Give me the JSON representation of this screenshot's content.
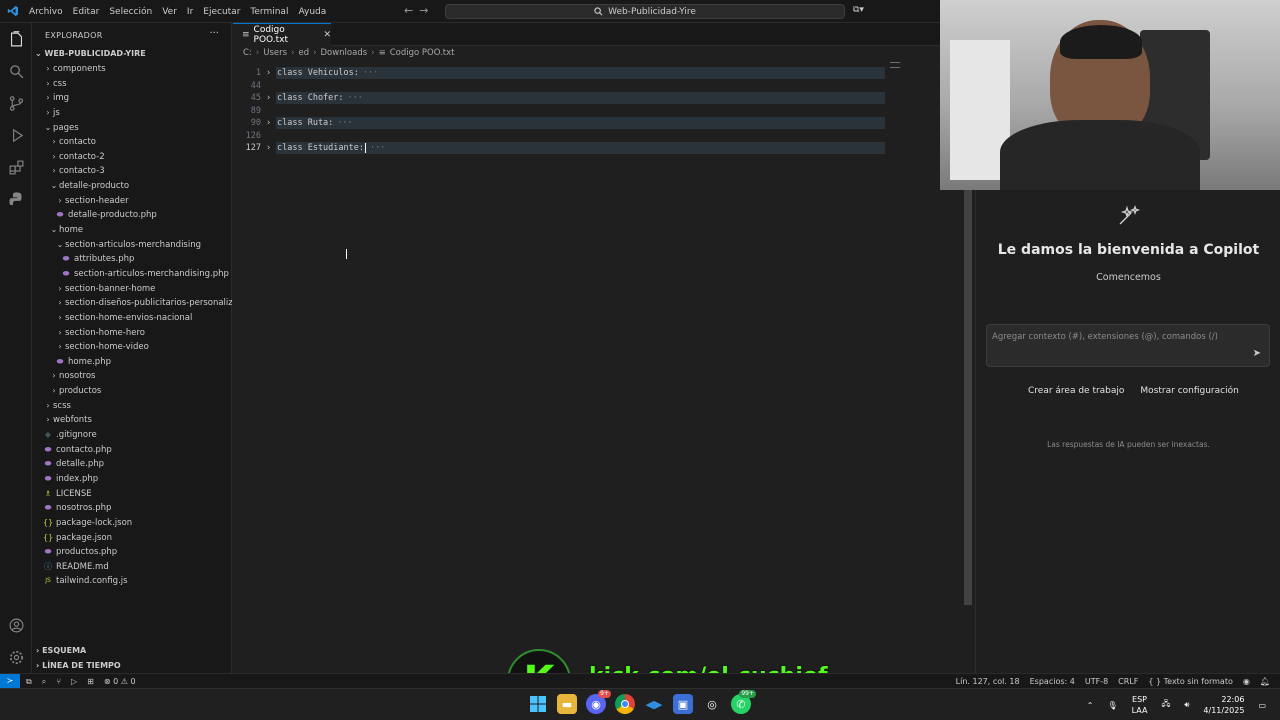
{
  "titlebar": {
    "menus": [
      "Archivo",
      "Editar",
      "Selección",
      "Ver",
      "Ir",
      "Ejecutar",
      "Terminal",
      "Ayuda"
    ],
    "search_text": "Web-Publicidad-Yire",
    "back_icon": "arrow-left-icon",
    "forward_icon": "arrow-right-icon"
  },
  "activitybar": {
    "items": [
      "explorer-icon",
      "search-icon",
      "source-control-icon",
      "run-debug-icon",
      "extensions-icon",
      "python-icon"
    ],
    "bottom": [
      "account-icon",
      "settings-gear-icon"
    ]
  },
  "sidebar": {
    "header": "EXPLORADOR",
    "more": "···",
    "root": "WEB-PUBLICIDAD-YIRE",
    "tree": [
      {
        "label": "components",
        "type": "folder",
        "open": false,
        "depth": 0
      },
      {
        "label": "css",
        "type": "folder",
        "open": false,
        "depth": 0
      },
      {
        "label": "img",
        "type": "folder",
        "open": false,
        "depth": 0
      },
      {
        "label": "js",
        "type": "folder",
        "open": false,
        "depth": 0
      },
      {
        "label": "pages",
        "type": "folder",
        "open": true,
        "depth": 0
      },
      {
        "label": "contacto",
        "type": "folder",
        "open": false,
        "depth": 1
      },
      {
        "label": "contacto-2",
        "type": "folder",
        "open": false,
        "depth": 1
      },
      {
        "label": "contacto-3",
        "type": "folder",
        "open": false,
        "depth": 1
      },
      {
        "label": "detalle-producto",
        "type": "folder",
        "open": true,
        "depth": 1
      },
      {
        "label": "section-header",
        "type": "folder",
        "open": false,
        "depth": 2
      },
      {
        "label": "detalle-producto.php",
        "type": "php",
        "depth": 2
      },
      {
        "label": "home",
        "type": "folder",
        "open": true,
        "depth": 1
      },
      {
        "label": "section-articulos-merchandising",
        "type": "folder",
        "open": true,
        "depth": 2
      },
      {
        "label": "attributes.php",
        "type": "php",
        "depth": 3
      },
      {
        "label": "section-articulos-merchandising.php",
        "type": "php",
        "depth": 3
      },
      {
        "label": "section-banner-home",
        "type": "folder",
        "open": false,
        "depth": 2
      },
      {
        "label": "section-diseños-publicitarios-personaliza...",
        "type": "folder",
        "open": false,
        "depth": 2
      },
      {
        "label": "section-home-envios-nacional",
        "type": "folder",
        "open": false,
        "depth": 2
      },
      {
        "label": "section-home-hero",
        "type": "folder",
        "open": false,
        "depth": 2
      },
      {
        "label": "section-home-video",
        "type": "folder",
        "open": false,
        "depth": 2
      },
      {
        "label": "home.php",
        "type": "php",
        "depth": 2
      },
      {
        "label": "nosotros",
        "type": "folder",
        "open": false,
        "depth": 1
      },
      {
        "label": "productos",
        "type": "folder",
        "open": false,
        "depth": 1
      },
      {
        "label": "scss",
        "type": "folder",
        "open": false,
        "depth": 0
      },
      {
        "label": "webfonts",
        "type": "folder",
        "open": false,
        "depth": 0
      },
      {
        "label": ".gitignore",
        "type": "git",
        "depth": 0
      },
      {
        "label": "contacto.php",
        "type": "php",
        "depth": 0
      },
      {
        "label": "detalle.php",
        "type": "php",
        "depth": 0
      },
      {
        "label": "index.php",
        "type": "php",
        "depth": 0
      },
      {
        "label": "LICENSE",
        "type": "lic",
        "depth": 0
      },
      {
        "label": "nosotros.php",
        "type": "php",
        "depth": 0
      },
      {
        "label": "package-lock.json",
        "type": "json",
        "depth": 0
      },
      {
        "label": "package.json",
        "type": "json",
        "depth": 0
      },
      {
        "label": "productos.php",
        "type": "php",
        "depth": 0
      },
      {
        "label": "README.md",
        "type": "md",
        "depth": 0
      },
      {
        "label": "tailwind.config.js",
        "type": "js",
        "depth": 0
      }
    ],
    "outline": "ESQUEMA",
    "timeline": "LÍNEA DE TIEMPO"
  },
  "editor": {
    "tab_label": "Codigo POO.txt",
    "breadcrumb": [
      "C:",
      "Users",
      "ed",
      "Downloads",
      "Codigo POO.txt"
    ],
    "lines": [
      {
        "num": "1",
        "code": "class Vehiculos:",
        "folded": true
      },
      {
        "num": "44",
        "code": "",
        "folded": false
      },
      {
        "num": "45",
        "code": "class Chofer:",
        "folded": true
      },
      {
        "num": "89",
        "code": "",
        "folded": false
      },
      {
        "num": "90",
        "code": "class Ruta:",
        "folded": true
      },
      {
        "num": "126",
        "code": "",
        "folded": false
      },
      {
        "num": "127",
        "code": "class Estudiante:",
        "folded": true,
        "active": true
      }
    ],
    "ellipsis": "···"
  },
  "copilot": {
    "welcome": "Le damos la bienvenida a Copilot",
    "start": "Comencemos",
    "placeholder": "Agregar contexto (#), extensiones (@), comandos (/)",
    "create_workspace": "Crear área de trabajo",
    "show_config": "Mostrar configuración",
    "disclaimer": "Las respuestas de IA pueden ser inexactas."
  },
  "statusbar": {
    "problems": "⊗ 0 ⚠ 0",
    "position": "Lín. 127, col. 18",
    "spaces": "Espacios: 4",
    "encoding": "UTF-8",
    "eol": "CRLF",
    "language": "Texto sin formato"
  },
  "taskbar": {
    "lang_top": "ESP",
    "lang_bottom": "LAA",
    "time": "22:06",
    "date": "4/11/2025",
    "discord_badge": "9+",
    "whatsapp_badge": "99+"
  },
  "overlay": {
    "kick_letter": "K",
    "kick_url": "kick.com/el-cuchiof"
  },
  "colors": {
    "accent": "#0078d4",
    "kick_green": "#53fc18",
    "editor_bg": "#1f1f1f",
    "sidebar_bg": "#181818"
  }
}
